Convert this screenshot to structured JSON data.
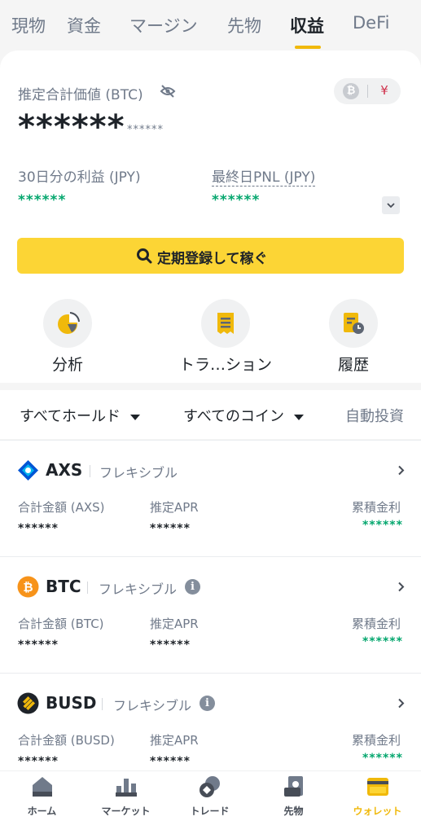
{
  "top_tabs": [
    "現物",
    "資金",
    "マージン",
    "先物",
    "収益",
    "DeFi"
  ],
  "active_tab": "収益",
  "summary": {
    "est_label": "推定合計価値 (BTC)",
    "balance_main": "******",
    "balance_sub": "******",
    "currency_btc": "₿",
    "currency_jpy": "¥",
    "pnl_30d_label": "30日分の利益 (JPY)",
    "pnl_30d_value": "******",
    "pnl_last_label": "最終日PNL (JPY)",
    "pnl_last_value": "******"
  },
  "subscribe_label": "定期登録して稼ぐ",
  "shortcuts": [
    {
      "label": "分析",
      "icon": "pie-chart-icon"
    },
    {
      "label": "トラ…ション",
      "icon": "receipt-icon"
    },
    {
      "label": "履歴",
      "icon": "history-icon"
    }
  ],
  "filters": {
    "holdings": "すべてホールド",
    "coins": "すべてのコイン",
    "auto_invest": "自動投資"
  },
  "coins": [
    {
      "symbol": "AXS",
      "type": "フレキシブル",
      "info": false,
      "amount_label": "合計金額 (AXS)",
      "amount": "******",
      "apr_label": "推定APR",
      "apr": "******",
      "interest_label": "累積金利",
      "interest": "******"
    },
    {
      "symbol": "BTC",
      "type": "フレキシブル",
      "info": true,
      "amount_label": "合計金額 (BTC)",
      "amount": "******",
      "apr_label": "推定APR",
      "apr": "******",
      "interest_label": "累積金利",
      "interest": "******"
    },
    {
      "symbol": "BUSD",
      "type": "フレキシブル",
      "info": true,
      "amount_label": "合計金額 (BUSD)",
      "amount": "******",
      "apr_label": "推定APR",
      "apr": "******",
      "interest_label": "累積金利",
      "interest": "******"
    }
  ],
  "info_glyph": "i",
  "bottom_nav": [
    {
      "label": "ホーム",
      "icon": "home-icon"
    },
    {
      "label": "マーケット",
      "icon": "markets-icon"
    },
    {
      "label": "トレード",
      "icon": "trade-icon"
    },
    {
      "label": "先物",
      "icon": "futures-icon"
    },
    {
      "label": "ウォレット",
      "icon": "wallet-icon"
    }
  ],
  "colors": {
    "accent": "#f0b90b",
    "button": "#fcd535",
    "positive": "#03a66d",
    "muted": "#707a8a"
  }
}
